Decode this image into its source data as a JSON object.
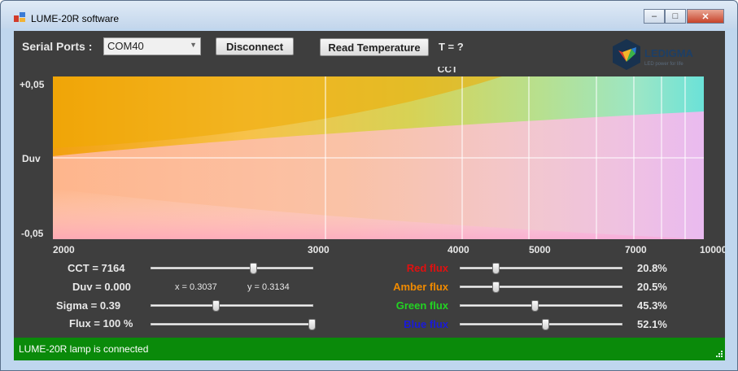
{
  "window": {
    "title": "LUME-20R software"
  },
  "toolbar": {
    "serial_label": "Serial Ports :",
    "port_value": "COM40",
    "disconnect_label": "Disconnect",
    "read_temp_label": "Read Temperature",
    "temperature_text": "T = ?"
  },
  "logo": {
    "brand": "LEDIGMA",
    "tagline": "LED power for life"
  },
  "chart": {
    "cct_title": "CCT",
    "duv_label": "Duv",
    "y_top_label": "+0,05",
    "y_bottom_label": "-0,05",
    "x_ticks": [
      "2000",
      "3000",
      "4000",
      "5000",
      "7000",
      "10000"
    ]
  },
  "controls": {
    "cct": {
      "label": "CCT = 7164",
      "position": 0.63
    },
    "duv": {
      "label": "Duv = 0.000"
    },
    "xy": {
      "x_text": "x = 0.3037",
      "y_text": "y = 0.3134"
    },
    "sigma": {
      "label": "Sigma = 0.39",
      "position": 0.39
    },
    "flux": {
      "label": "Flux = 100 %",
      "position": 1.0
    }
  },
  "channels": [
    {
      "name": "Red flux",
      "color": "#e01010",
      "percent": "20.8%",
      "position": 0.208
    },
    {
      "name": "Amber flux",
      "color": "#f08a00",
      "percent": "20.5%",
      "position": 0.205
    },
    {
      "name": "Green flux",
      "color": "#22d422",
      "percent": "45.3%",
      "position": 0.453
    },
    {
      "name": "Blue flux",
      "color": "#1a1ad8",
      "percent": "52.1%",
      "position": 0.521
    }
  ],
  "status": {
    "text": "LUME-20R lamp is connected"
  },
  "colors": {
    "client_bg": "#3e3e3e",
    "status_bg": "#0a8a0a"
  }
}
